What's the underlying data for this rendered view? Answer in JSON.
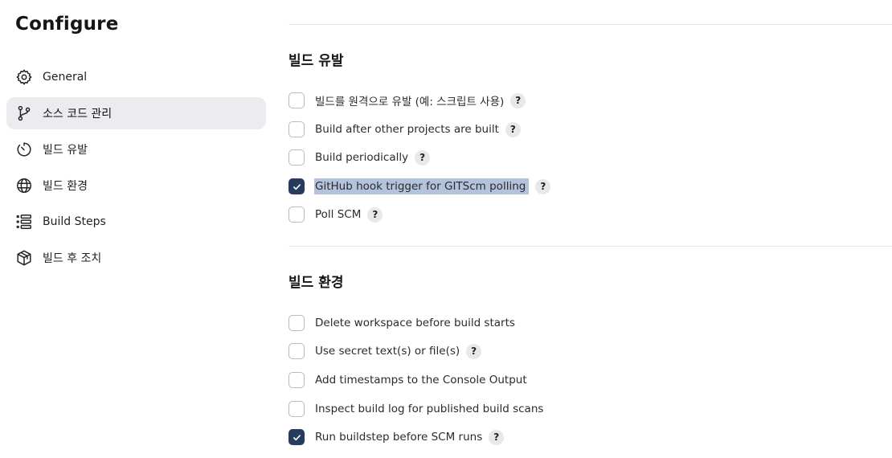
{
  "sidebar": {
    "title": "Configure",
    "items": [
      {
        "label": "General",
        "icon": "gear-icon",
        "active": false
      },
      {
        "label": "소스 코드 관리",
        "icon": "branch-icon",
        "active": true
      },
      {
        "label": "빌드 유발",
        "icon": "timer-icon",
        "active": false
      },
      {
        "label": "빌드 환경",
        "icon": "globe-icon",
        "active": false
      },
      {
        "label": "Build Steps",
        "icon": "list-icon",
        "active": false
      },
      {
        "label": "빌드 후 조치",
        "icon": "package-icon",
        "active": false
      }
    ]
  },
  "build_triggers": {
    "title": "빌드 유발",
    "options": [
      {
        "label": "빌드를 원격으로 유발 (예: 스크립트 사용)",
        "checked": false,
        "help": "?"
      },
      {
        "label": "Build after other projects are built",
        "checked": false,
        "help": "?"
      },
      {
        "label": "Build periodically",
        "checked": false,
        "help": "?"
      },
      {
        "label": "GitHub hook trigger for GITScm polling",
        "checked": true,
        "help": "?"
      },
      {
        "label": "Poll SCM",
        "checked": false,
        "help": "?"
      }
    ]
  },
  "build_environment": {
    "title": "빌드 환경",
    "options": [
      {
        "label": "Delete workspace before build starts",
        "checked": false
      },
      {
        "label": "Use secret text(s) or file(s)",
        "checked": false,
        "help": "?"
      },
      {
        "label": "Add timestamps to the Console Output",
        "checked": false
      },
      {
        "label": "Inspect build log for published build scans",
        "checked": false
      },
      {
        "label": "Run buildstep before SCM runs",
        "checked": true,
        "help": "?"
      }
    ]
  },
  "colors": {
    "checkbox_checked": "#273c5c",
    "active_nav_bg": "#ececf0",
    "text_selection": "#b4c3dc"
  }
}
